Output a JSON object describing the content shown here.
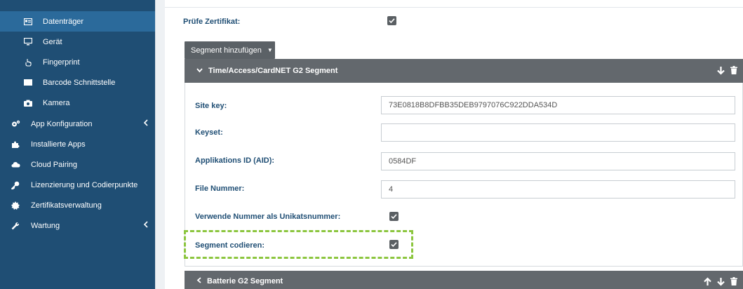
{
  "sidebar": {
    "items": [
      {
        "label": "Datenträger",
        "icon": "id-card-icon",
        "level": "sub",
        "active": true
      },
      {
        "label": "Gerät",
        "icon": "monitor-icon",
        "level": "sub",
        "active": false
      },
      {
        "label": "Fingerprint",
        "icon": "hand-pointer-icon",
        "level": "sub",
        "active": false
      },
      {
        "label": "Barcode Schnittstelle",
        "icon": "barcode-icon",
        "level": "sub",
        "active": false
      },
      {
        "label": "Kamera",
        "icon": "camera-icon",
        "level": "sub",
        "active": false
      },
      {
        "label": "App Konfiguration",
        "icon": "cogs-icon",
        "level": "top",
        "active": false,
        "chevron": "‹"
      },
      {
        "label": "Installierte Apps",
        "icon": "puzzle-icon",
        "level": "top",
        "active": false
      },
      {
        "label": "Cloud Pairing",
        "icon": "cloud-icon",
        "level": "top",
        "active": false
      },
      {
        "label": "Lizenzierung und Codierpunkte",
        "icon": "key-icon",
        "level": "top",
        "active": false
      },
      {
        "label": "Zertifikatsverwaltung",
        "icon": "certificate-icon",
        "level": "top",
        "active": false
      },
      {
        "label": "Wartung",
        "icon": "wrench-icon",
        "level": "top",
        "active": false,
        "chevron": "‹"
      }
    ]
  },
  "main": {
    "pruefe_label": "Prüfe Zertifikat:",
    "pruefe_checked": true,
    "add_segment_label": "Segment hinzufügen",
    "add_segment_caret": "▼",
    "segment1": {
      "title": "Time/Access/CardNET G2 Segment",
      "fields": [
        {
          "label": "Site key:",
          "value": "73E0818B8DFBB35DEB9797076C922DDA534D"
        },
        {
          "label": "Keyset:",
          "value": ""
        },
        {
          "label": "Applikations ID (AID):",
          "value": "0584DF"
        },
        {
          "label": "File Nummer:",
          "value": "4"
        }
      ],
      "verwende_label": "Verwende Nummer als Unikatsnummer:",
      "verwende_checked": true,
      "codieren_label": "Segment codieren:",
      "codieren_checked": true
    },
    "segment2": {
      "title": "Batterie G2 Segment"
    }
  },
  "colors": {
    "sidebar_bg": "#1f4e74",
    "sidebar_active": "#2b6a9b",
    "panel_header": "#63686d",
    "label_blue": "#1f4e74",
    "highlight_green": "#8cc63f"
  }
}
